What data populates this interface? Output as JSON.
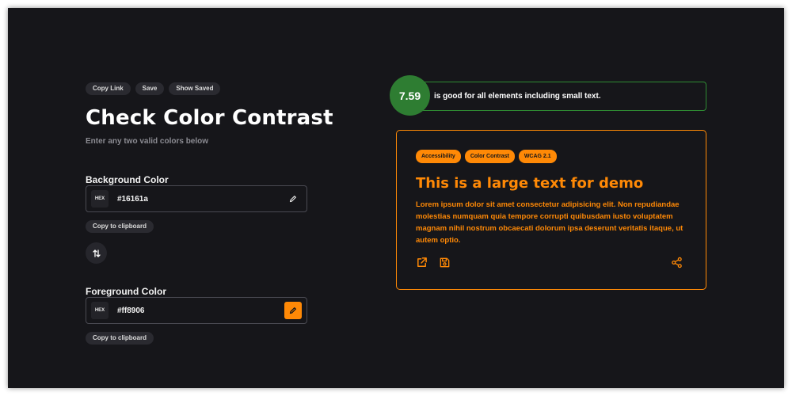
{
  "toolbar": {
    "copy_link": "Copy Link",
    "save": "Save",
    "show_saved": "Show Saved"
  },
  "header": {
    "title": "Check Color Contrast",
    "subtitle": "Enter any two valid colors below"
  },
  "background": {
    "label": "Background Color",
    "format": "HEX",
    "value": "#16161a",
    "copy_label": "Copy to clipboard"
  },
  "foreground": {
    "label": "Foreground Color",
    "format": "HEX",
    "value": "#ff8906",
    "copy_label": "Copy to clipboard"
  },
  "result": {
    "ratio": "7.59",
    "message": "is good for all elements including small text.",
    "status_color": "#2e7d32"
  },
  "demo": {
    "tags": [
      "Accessibility",
      "Color Contrast",
      "WCAG 2.1"
    ],
    "title": "This is a large text for demo",
    "body": "Lorem ipsum dolor sit amet consectetur adipisicing elit. Non repudiandae molestias numquam quia tempore corrupti quibusdam iusto voluptatem magnam nihil nostrum obcaecati dolorum ipsa deserunt veritatis itaque, ut autem optio.",
    "icons": [
      "external-link-icon",
      "save-icon",
      "share-icon"
    ]
  },
  "colors": {
    "background": "#16161a",
    "accent": "#ff8906",
    "success": "#2e7d32"
  }
}
